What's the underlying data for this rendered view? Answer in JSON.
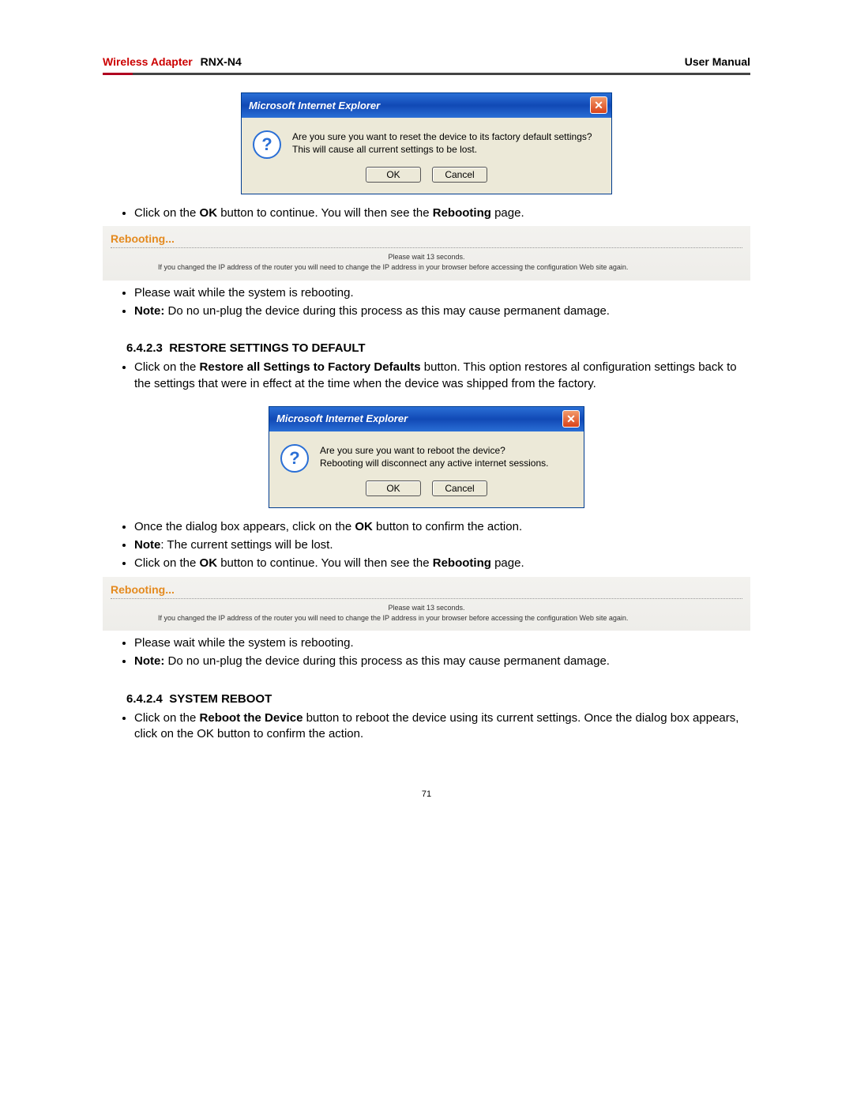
{
  "header": {
    "brand": "Wireless Adapter",
    "model": "RNX-N4",
    "right": "User Manual"
  },
  "dialog1": {
    "title": "Microsoft Internet Explorer",
    "close_glyph": "✕",
    "icon_glyph": "?",
    "line1": "Are you sure you want to reset the device to its factory default settings?",
    "line2": "This will cause all current settings to be lost.",
    "ok": "OK",
    "cancel": "Cancel"
  },
  "bul_after_d1": [
    {
      "pre": "Click on the ",
      "b1": "OK",
      "mid": " button to continue.  You will then see the ",
      "b2": "Rebooting",
      "post": " page."
    }
  ],
  "reboot_panel": {
    "title": "Rebooting...",
    "wait": "Please wait 13 seconds.",
    "note": "If you changed the IP address of the router you will need to change the IP address in your browser before accessing the configuration Web site again."
  },
  "bul_wait_1": [
    {
      "text": "Please wait while the system is rebooting."
    },
    {
      "b": "Note:",
      "text": " Do no un-plug the device during this process as this may cause permanent damage."
    }
  ],
  "section_restore": {
    "num": "6.4.2.3",
    "title": "RESTORE SETTINGS TO DEFAULT",
    "desc_pre": "Click on the ",
    "desc_b": "Restore all Settings to Factory Defaults",
    "desc_post": " button. This option restores al configuration settings back to the settings that were in effect at the time when the device was shipped from the factory."
  },
  "dialog2": {
    "title": "Microsoft Internet Explorer",
    "close_glyph": "✕",
    "icon_glyph": "?",
    "line1": "Are you sure you want to reboot the device?",
    "line2": "Rebooting will disconnect any active internet sessions.",
    "ok": "OK",
    "cancel": "Cancel"
  },
  "bul_after_d2": [
    {
      "pre": "Once the dialog box appears, click on the ",
      "b1": "OK",
      "post": " button to confirm the action."
    },
    {
      "b1": "Note",
      "post": ": The current settings will be lost."
    },
    {
      "pre": "Click on the ",
      "b1": "OK",
      "mid": " button to continue.  You will then see the ",
      "b2": "Rebooting",
      "post": " page."
    }
  ],
  "bul_wait_2": [
    {
      "text": "Please wait while the system is rebooting."
    },
    {
      "b": "Note:",
      "text": " Do no un-plug the device during this process as this may cause permanent damage."
    }
  ],
  "section_reboot": {
    "num": "6.4.2.4",
    "title": "SYSTEM REBOOT",
    "desc_pre": "Click on the ",
    "desc_b": "Reboot the Device",
    "desc_post": " button to reboot the device using its current settings. Once the dialog box appears, click on the OK button to confirm the action."
  },
  "page_number": "71"
}
